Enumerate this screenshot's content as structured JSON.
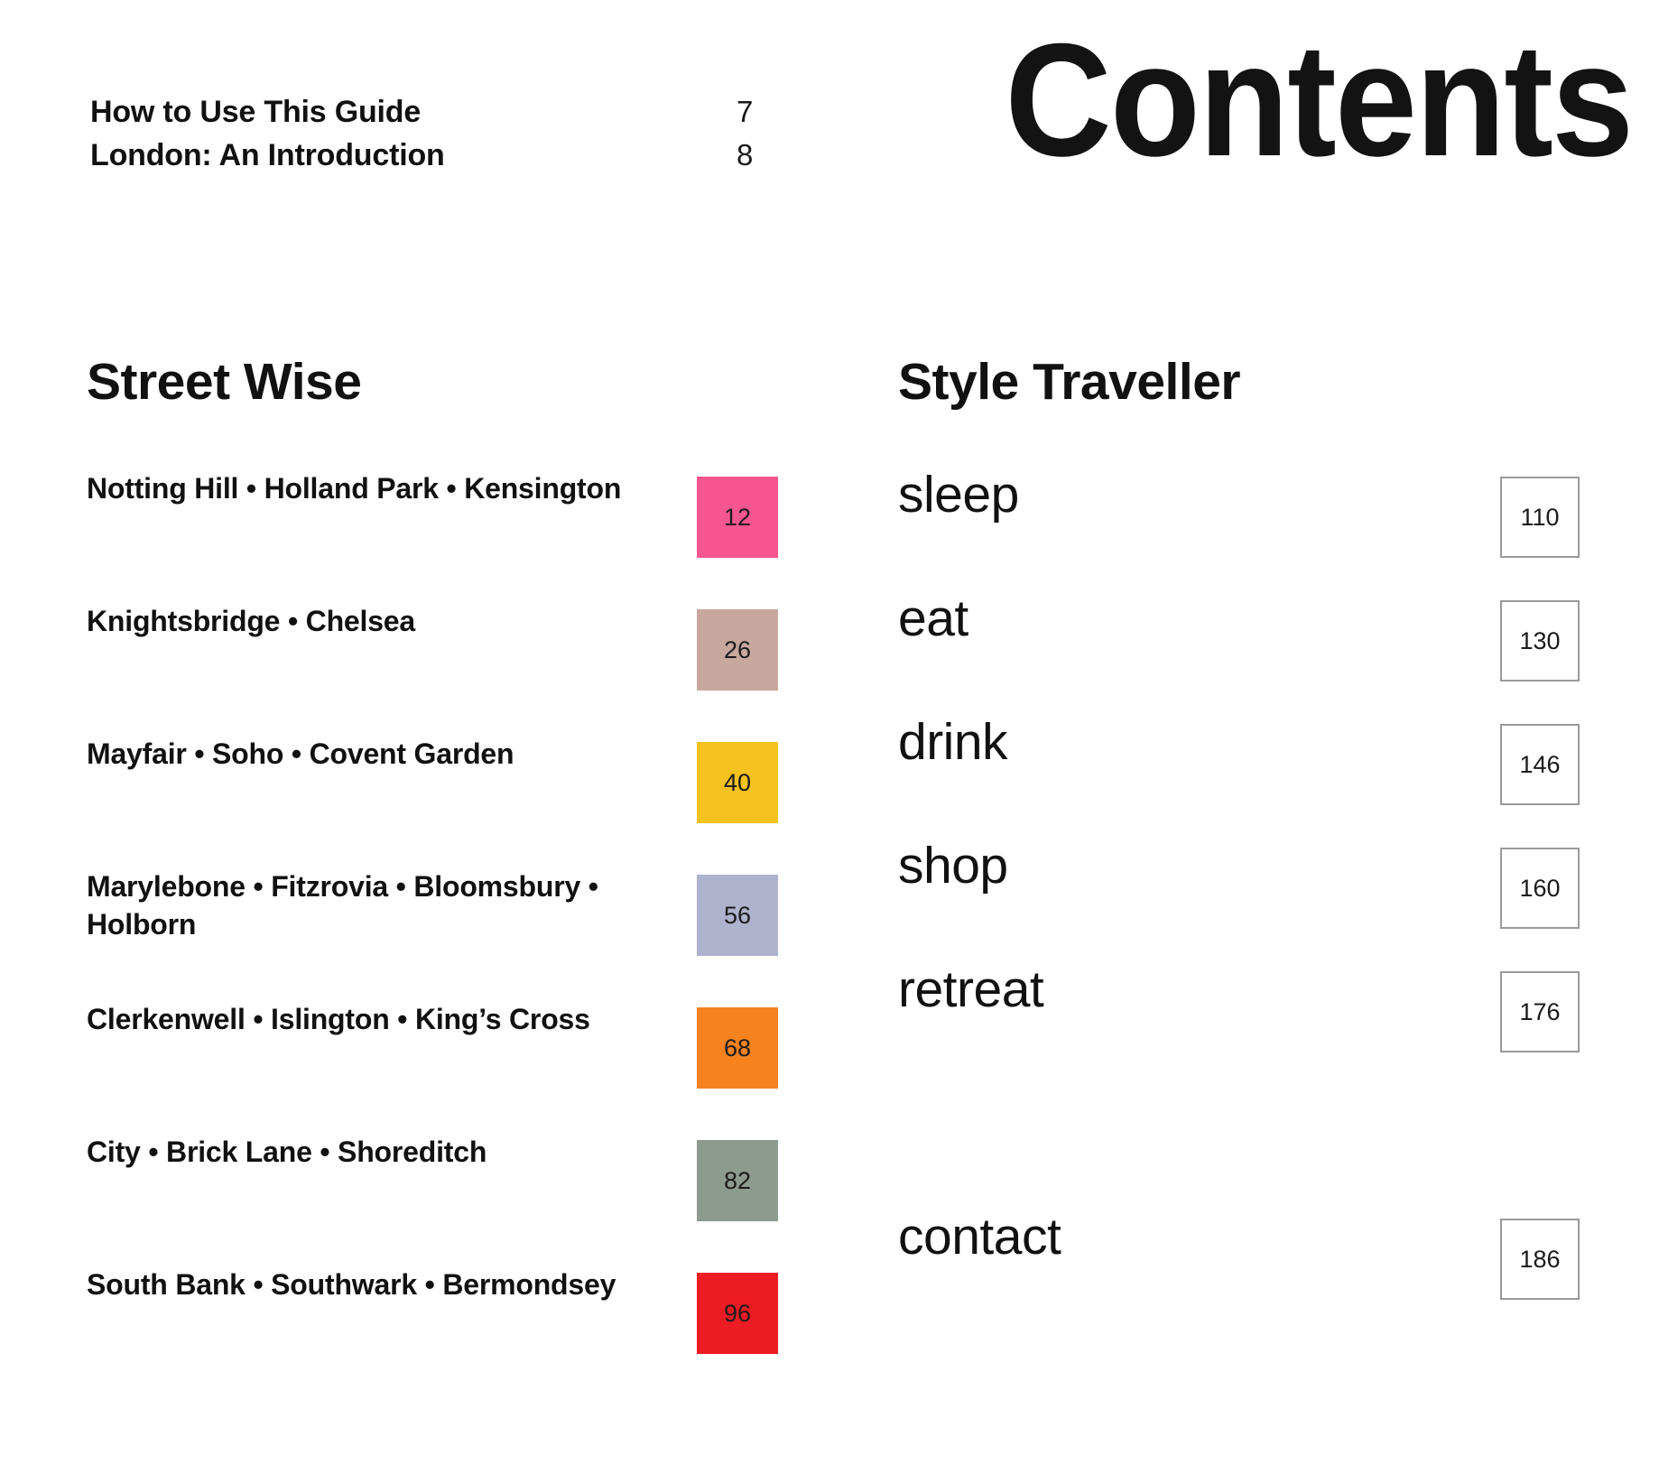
{
  "page": {
    "title": "Contents"
  },
  "frontmatter": [
    {
      "label": "How to Use This Guide",
      "page": "7"
    },
    {
      "label": "London: An Introduction",
      "page": "8"
    }
  ],
  "street_wise": {
    "heading": "Street Wise",
    "rows": [
      {
        "label": "Notting Hill • Holland Park • Kensington",
        "page": "12",
        "color": "#F8568F"
      },
      {
        "label": "Knightsbridge • Chelsea",
        "page": "26",
        "color": "#C8A79E"
      },
      {
        "label": "Mayfair • Soho • Covent Garden",
        "page": "40",
        "color": "#F6C220"
      },
      {
        "label": "Marylebone • Fitzrovia • Bloomsbury • Holborn",
        "page": "56",
        "color": "#AEB3CD"
      },
      {
        "label": "Clerkenwell • Islington • King’s Cross",
        "page": "68",
        "color": "#F5821F"
      },
      {
        "label": "City • Brick Lane • Shoreditch",
        "page": "82",
        "color": "#8C9B8E"
      },
      {
        "label": "South Bank • Southwark • Bermondsey",
        "page": "96",
        "color": "#ED1C24"
      }
    ]
  },
  "style_traveller": {
    "heading": "Style Traveller",
    "rows": [
      {
        "label": "sleep",
        "page": "110"
      },
      {
        "label": "eat",
        "page": "130"
      },
      {
        "label": "drink",
        "page": "146"
      },
      {
        "label": "shop",
        "page": "160"
      },
      {
        "label": "retreat",
        "page": "176"
      },
      {
        "label": "",
        "page": ""
      },
      {
        "label": "contact",
        "page": "186"
      }
    ]
  }
}
